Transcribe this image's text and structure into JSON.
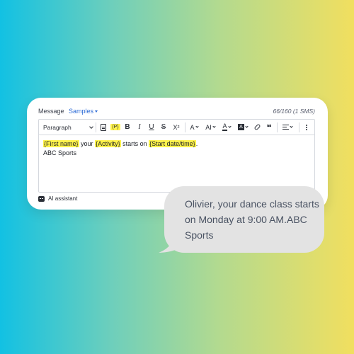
{
  "message": {
    "label": "Message",
    "samples_label": "Samples",
    "counter": "66/160 (1 SMS)"
  },
  "toolbar": {
    "paragraph": "Paragraph",
    "personalize": "{P}",
    "bold": "B",
    "italic": "I",
    "underline": "U",
    "strikethrough": "S",
    "superscript": "X²",
    "font_size": "A",
    "font_family": "AI",
    "font_color": "A",
    "bg_color": "A",
    "quote": "❝"
  },
  "editor": {
    "tokens": [
      "{First name}",
      "{Activity}",
      "{Start date/time}"
    ],
    "text_your": "your",
    "text_starts_on": "starts on",
    "text_period": ".",
    "line2": "ABC Sports"
  },
  "ai_assistant": "AI assistant",
  "sms_preview": "Olivier, your dance class starts on Monday at 9:00 AM.ABC Sports",
  "colors": {
    "highlight": "#fff34a",
    "link": "#2c6bd6",
    "bubble": "#e3e3e3"
  }
}
